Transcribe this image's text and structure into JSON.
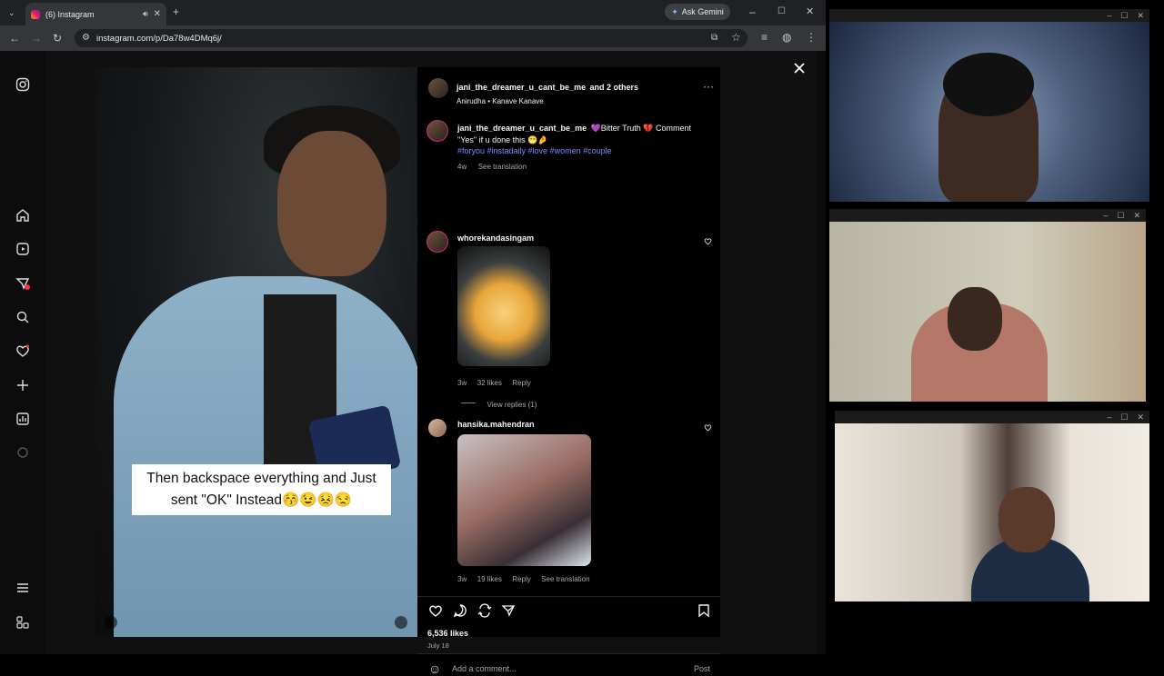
{
  "browser": {
    "tab_title": "(6) Instagram",
    "url": "instagram.com/p/Da78w4DMq6j/",
    "gemini_label": "Ask Gemini"
  },
  "post": {
    "header_user": "jani_the_dreamer_u_cant_be_me",
    "header_others": "and 2 others",
    "header_audio": "Anirudha • Kanave Kanave",
    "caption_user": "jani_the_dreamer_u_cant_be_me",
    "caption_text": "💜Bitter Truth 💔 Comment \"Yes\" if u done this 😁🤌",
    "caption_tags": "#foryou #instadaily #love #women #couple",
    "caption_age": "4w",
    "caption_translate": "See translation",
    "overlay_text": "Then backspace everything and Just sent \"OK\" Instead😚😉😣😒",
    "likes": "6,536 likes",
    "date": "July 18",
    "comment_placeholder": "Add a comment...",
    "post_button": "Post"
  },
  "comments": [
    {
      "user": "whorekandasingam",
      "age": "3w",
      "likes": "32 likes",
      "reply": "Reply",
      "view_replies": "View replies (1)"
    },
    {
      "user": "hansika.mahendran",
      "age": "3w",
      "likes": "19 likes",
      "reply": "Reply",
      "translate": "See translation"
    }
  ],
  "colors": {
    "accent_link": "#7c8cff",
    "background": "#000000",
    "notification": "#ff3040"
  }
}
